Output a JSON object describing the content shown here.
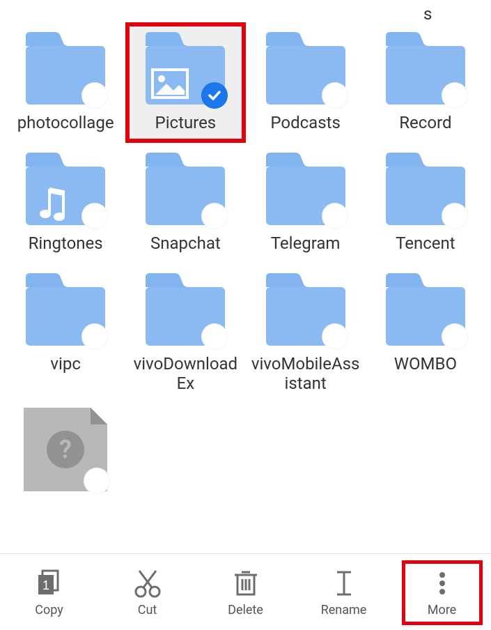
{
  "top_letter": "s",
  "folders": [
    {
      "name": "photocollage",
      "selected": false,
      "overlay": null,
      "highlighted": false
    },
    {
      "name": "Pictures",
      "selected": true,
      "overlay": "image",
      "highlighted": true
    },
    {
      "name": "Podcasts",
      "selected": false,
      "overlay": null,
      "highlighted": false
    },
    {
      "name": "Record",
      "selected": false,
      "overlay": null,
      "highlighted": false
    },
    {
      "name": "Ringtones",
      "selected": false,
      "overlay": "music",
      "highlighted": false
    },
    {
      "name": "Snapchat",
      "selected": false,
      "overlay": null,
      "highlighted": false
    },
    {
      "name": "Telegram",
      "selected": false,
      "overlay": null,
      "highlighted": false
    },
    {
      "name": "Tencent",
      "selected": false,
      "overlay": null,
      "highlighted": false
    },
    {
      "name": "vipc",
      "selected": false,
      "overlay": null,
      "highlighted": false
    },
    {
      "name": "vivoDownloadEx",
      "selected": false,
      "overlay": null,
      "highlighted": false
    },
    {
      "name": "vivoMobileAssistant",
      "selected": false,
      "overlay": null,
      "highlighted": false
    },
    {
      "name": "WOMBO",
      "selected": false,
      "overlay": null,
      "highlighted": false
    }
  ],
  "unknown_file_symbol": "?",
  "toolbar": {
    "copy": {
      "label": "Copy",
      "count": "1"
    },
    "cut": {
      "label": "Cut"
    },
    "delete": {
      "label": "Delete"
    },
    "rename": {
      "label": "Rename"
    },
    "more": {
      "label": "More",
      "highlighted": true
    }
  }
}
